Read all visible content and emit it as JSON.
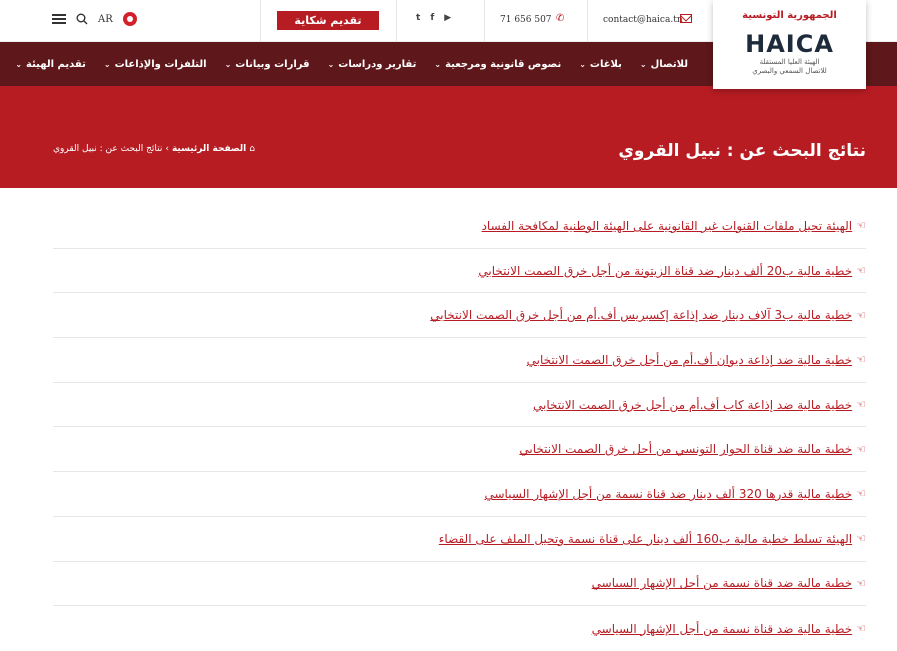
{
  "topbar": {
    "lang": "AR",
    "complaint_button": "تقديم شكاية",
    "phone": "71 656 507",
    "email": "contact@haica.tn"
  },
  "logo": {
    "arabic_top": "الجمهورية التونسية",
    "name": "HAICA",
    "subtitle_line1": "الهيئة العليا المستقلة",
    "subtitle_line2": "للاتصال السمعي والبصري"
  },
  "nav": [
    {
      "label": "تقديم الهيئة"
    },
    {
      "label": "التلفزات والإذاعات"
    },
    {
      "label": "قرارات وبيانات"
    },
    {
      "label": "تقارير ودراسات"
    },
    {
      "label": "نصوص قانونية ومرجعية"
    },
    {
      "label": "بلاغات"
    },
    {
      "label": "للاتصال"
    }
  ],
  "hero": {
    "title": "نتائج البحث عن : نبيل القروي",
    "breadcrumb_home": "الصفحة الرئيسية",
    "breadcrumb_sep": "›",
    "breadcrumb_current": "نتائج البحث عن : نبيل القروي"
  },
  "results": [
    "الهيئة تحيل ملفات القنوات غير القانونية على الهيئة الوطنية لمكافحة الفساد",
    "خطية مالية ب20 ألف دينار ضد قناة الزيتونة من أجل خرق الصمت الانتخابي",
    "خطية مالية ب3 آلاف دينار ضد إذاعة إكسبريس أف.أم من أجل خرق الصمت الانتخابي",
    "خطية مالية ضد إذاعة ديوان أف.أم من أجل خرق الصمت الانتخابي",
    "خطية مالية ضد إذاعة كاب أف.أم من أجل خرق الصمت الانتخابي",
    "خطية مالية ضد قناة الحوار التونسي من أجل خرق الصمت الانتخابي",
    "خطية مالية قدرها 320 ألف دينار ضد قناة نسمة من أجل الإشهار السياسي",
    "الهيئة تسلط خطية مالية ب160 ألف دينار على قناة نسمة وتحيل الملف على القضاء",
    "خطية مالية ضد قناة نسمة من أجل الإشهار السياسي",
    "خطية مالية ضد قناة نسمة من أجل الإشهار السياسي"
  ],
  "colors": {
    "accent": "#b71c23",
    "nav_bg": "#5e171a"
  }
}
